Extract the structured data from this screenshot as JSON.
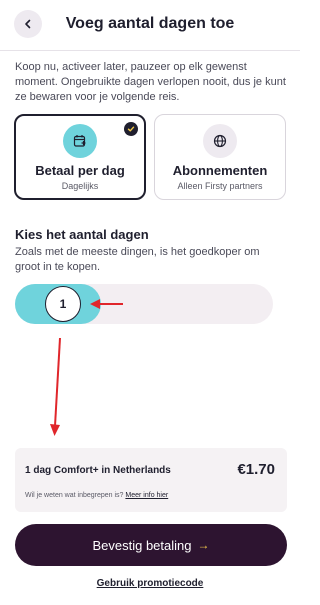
{
  "header": {
    "title": "Voeg aantal dagen toe",
    "back_icon": "chevron-left-icon"
  },
  "intro": "Koop nu, activeer later, pauzeer op elk gewenst moment. Ongebruikte dagen verlopen nooit, dus je kunt ze bewaren voor je volgende reis.",
  "plans": [
    {
      "title": "Betaal per dag",
      "subtitle": "Dagelijks",
      "icon": "calendar-plus-icon",
      "selected": true
    },
    {
      "title": "Abonnementen",
      "subtitle": "Alleen Firsty partners",
      "icon": "globe-icon",
      "selected": false
    }
  ],
  "days": {
    "title": "Kies het aantal dagen",
    "subtitle": "Zoals met de meeste dingen, is het goedkoper om groot in te kopen.",
    "value": "1"
  },
  "summary": {
    "name": "1 dag Comfort+ in Netherlands",
    "price": "€1.70",
    "info_text": "Wil je weten wat inbegrepen is?",
    "info_link": "Meer info hier"
  },
  "confirm_label": "Bevestig betaling",
  "confirm_arrow": "→",
  "promo_label": "Gebruik promotiecode",
  "colors": {
    "accent": "#6fd3dc",
    "dark": "#2d1430",
    "annotation_arrow": "#e0262b"
  }
}
